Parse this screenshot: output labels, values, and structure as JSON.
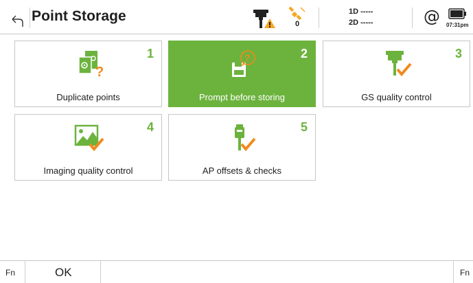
{
  "header": {
    "title": "Point Storage",
    "satellite_count": "0",
    "precision_1d": "1D -----",
    "precision_2d": "2D -----",
    "at_symbol": "@",
    "time": "07:31pm",
    "icons": [
      "back-icon",
      "gs-receiver-warning-icon",
      "satellite-icon",
      "battery-icon"
    ]
  },
  "tiles": [
    {
      "number": "1",
      "label": "Duplicate points",
      "icon": "duplicate-points-icon",
      "active": false
    },
    {
      "number": "2",
      "label": "Prompt before storing",
      "icon": "prompt-store-icon",
      "active": true
    },
    {
      "number": "3",
      "label": "GS quality control",
      "icon": "gs-quality-icon",
      "active": false
    },
    {
      "number": "4",
      "label": "Imaging quality control",
      "icon": "imaging-quality-icon",
      "active": false
    },
    {
      "number": "5",
      "label": "AP offsets & checks",
      "icon": "ap-offsets-icon",
      "active": false
    }
  ],
  "footer": {
    "fn_left": "Fn",
    "ok": "OK",
    "fn_right": "Fn"
  },
  "colors": {
    "accent_green": "#6cb33e",
    "check_orange": "#f08a1c",
    "warning_orange": "#f5a623"
  }
}
